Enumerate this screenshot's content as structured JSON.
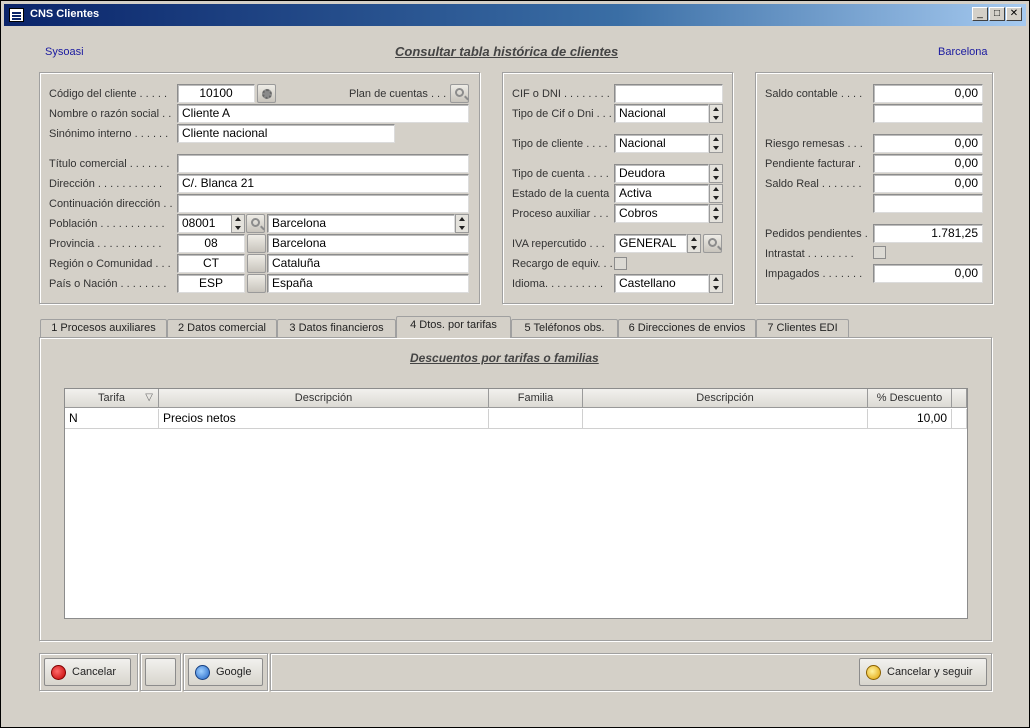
{
  "window": {
    "title": "CNS Clientes",
    "controls": {
      "minimize": "_",
      "maximize": "□",
      "close": "✕"
    }
  },
  "header": {
    "company": "Sysoasi",
    "title": "Consultar tabla histórica de clientes",
    "city": "Barcelona"
  },
  "left_panel": {
    "codigo_label": "Código del cliente . . . . .",
    "codigo_value": "10100",
    "plan_label": "Plan de cuentas . . .",
    "nombre_label": "Nombre o razón social . .",
    "nombre_value": "Cliente A",
    "sinonimo_label": "Sinónimo interno . . . . . .",
    "sinonimo_value": "Cliente nacional",
    "titulo_label": "Título comercial . . . . . . .",
    "titulo_value": "",
    "direccion_label": "Dirección . . . . . . . . . . .",
    "direccion_value": "C/. Blanca 21",
    "continuacion_label": "Continuación dirección . .",
    "continuacion_value": "",
    "poblacion_label": "Población . . . . . . . . . . .",
    "poblacion_code": "08001",
    "poblacion_value": "Barcelona",
    "provincia_label": "Provincia . . . . . . . . . . .",
    "provincia_code": "08",
    "provincia_value": "Barcelona",
    "region_label": "Región o Comunidad . . .",
    "region_code": "CT",
    "region_value": "Cataluña",
    "pais_label": "País o Nación . . . . . . . .",
    "pais_code": "ESP",
    "pais_value": "España"
  },
  "middle_panel": {
    "cif_label": "CIF o DNI . . . . . . . .",
    "cif_value": "",
    "tipo_cif_label": "Tipo de Cif o Dni . . .",
    "tipo_cif_value": "Nacional",
    "tipo_cliente_label": "Tipo de cliente . . . .",
    "tipo_cliente_value": "Nacional",
    "tipo_cuenta_label": "Tipo de cuenta . . . .",
    "tipo_cuenta_value": "Deudora",
    "estado_label": "Estado de la cuenta .",
    "estado_value": "Activa",
    "proceso_label": "Proceso auxiliar . . .",
    "proceso_value": "Cobros",
    "iva_label": "IVA repercutido . . .",
    "iva_value": "GENERAL",
    "recargo_label": "Recargo de equiv. . .",
    "idioma_label": "Idioma. . . . . . . . . .",
    "idioma_value": "Castellano"
  },
  "right_panel": {
    "saldo_contable_label": "Saldo contable . . . .",
    "saldo_contable_value": "0,00",
    "riesgo_label": "Riesgo remesas . . .",
    "riesgo_value": "0,00",
    "pendiente_label": "Pendiente facturar .",
    "pendiente_value": "0,00",
    "saldo_real_label": "Saldo Real . . . . . . .",
    "saldo_real_value": "0,00",
    "pedidos_label": "Pedidos pendientes .",
    "pedidos_value": "1.781,25",
    "intrastat_label": "Intrastat . . . . . . . .",
    "impagados_label": "Impagados . . . . . . .",
    "impagados_value": "0,00"
  },
  "tabs": [
    {
      "label": "1  Procesos auxiliares"
    },
    {
      "label": "2  Datos comercial"
    },
    {
      "label": "3  Datos financieros"
    },
    {
      "label": "4  Dtos. por tarifas"
    },
    {
      "label": "5  Teléfonos obs."
    },
    {
      "label": "6  Direcciones de envios"
    },
    {
      "label": "7  Clientes EDI"
    }
  ],
  "tab_content": {
    "title": "Descuentos por tarifas o familias",
    "columns": [
      "Tarifa",
      "Descripción",
      "Familia",
      "Descripción",
      "% Descuento"
    ],
    "rows": [
      {
        "tarifa": "N",
        "descripcion": "Precios netos",
        "familia": "",
        "descripcion2": "",
        "descuento": "10,00"
      }
    ]
  },
  "footer": {
    "cancelar": "Cancelar",
    "google": "Google",
    "cancelar_seguir": "Cancelar y seguir"
  },
  "colors": {
    "title_gradient_start": "#0a246a",
    "header_blue": "#1a1aa0",
    "background": "#d4d0c8"
  }
}
